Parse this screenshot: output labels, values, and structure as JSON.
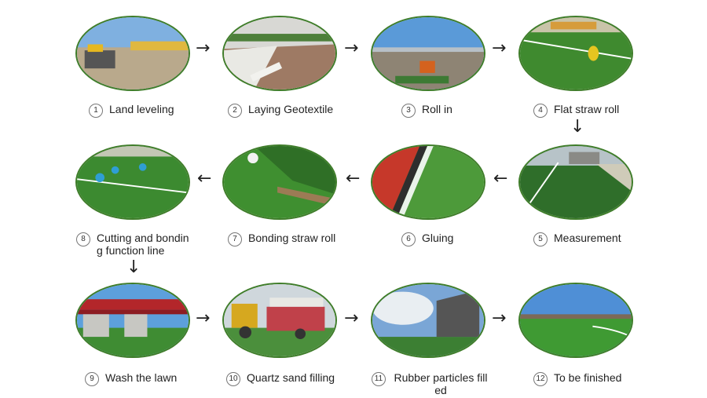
{
  "steps": [
    {
      "num": "1",
      "label": "Land leveling"
    },
    {
      "num": "2",
      "label": "Laying Geotextile"
    },
    {
      "num": "3",
      "label": "Roll in"
    },
    {
      "num": "4",
      "label": "Flat straw roll"
    },
    {
      "num": "5",
      "label": "Measurement"
    },
    {
      "num": "6",
      "label": "Gluing"
    },
    {
      "num": "7",
      "label": "Bonding straw roll"
    },
    {
      "num": "8",
      "label": "Cutting and bondin g function line"
    },
    {
      "num": "9",
      "label": "Wash the lawn"
    },
    {
      "num": "10",
      "label": "Quartz sand filling"
    },
    {
      "num": "11",
      "label": "Rubber particles fill ed"
    },
    {
      "num": "12",
      "label": "To be finished"
    }
  ],
  "arrows": {
    "right": "→",
    "left": "←",
    "down": "↓"
  }
}
